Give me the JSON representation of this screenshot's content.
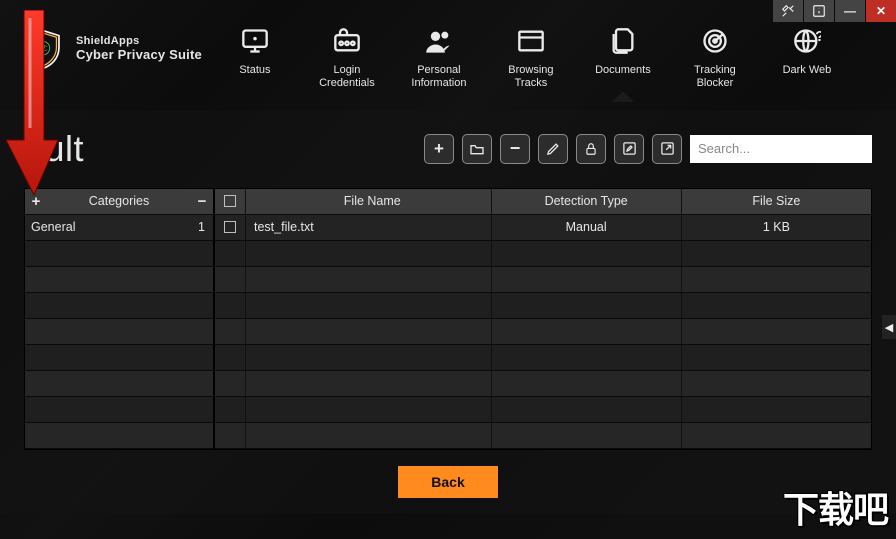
{
  "brand": {
    "top": "ShieldApps",
    "bottom": "Cyber Privacy Suite"
  },
  "nav": {
    "status": "Status",
    "login": "Login\nCredentials",
    "personal": "Personal\nInformation",
    "browsing": "Browsing\nTracks",
    "documents": "Documents",
    "tracking": "Tracking\nBlocker",
    "darkweb": "Dark Web"
  },
  "page": {
    "title": "ault"
  },
  "search": {
    "placeholder": "Search..."
  },
  "categories": {
    "header": "Categories",
    "items": [
      {
        "name": "General",
        "count": "1"
      }
    ]
  },
  "files": {
    "headers": {
      "filename": "File Name",
      "detection": "Detection Type",
      "size": "File Size"
    },
    "rows": [
      {
        "filename": "test_file.txt",
        "detection": "Manual",
        "size": "1 KB"
      }
    ]
  },
  "actions": {
    "back": "Back"
  },
  "watermark": "下载吧"
}
